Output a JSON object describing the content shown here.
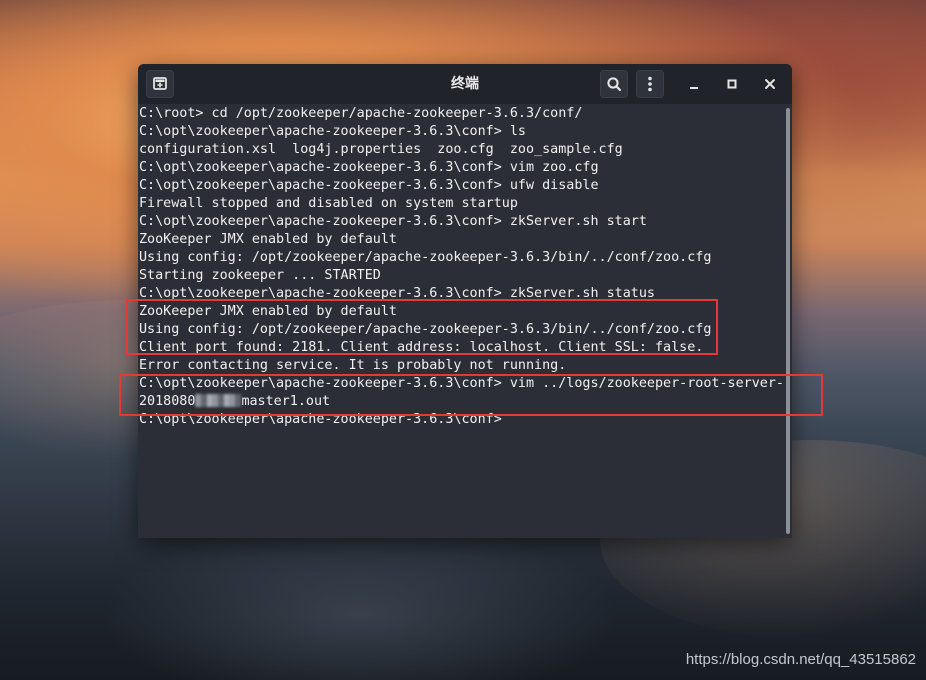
{
  "window": {
    "title": "终端",
    "icons": {
      "new_tab": "new-tab-icon",
      "search": "search-icon",
      "menu": "kebab-menu-icon",
      "minimize": "minimize-icon",
      "maximize": "maximize-icon",
      "close": "close-icon"
    }
  },
  "terminal": {
    "lines": [
      "C:\\root> cd /opt/zookeeper/apache-zookeeper-3.6.3/conf/",
      "C:\\opt\\zookeeper\\apache-zookeeper-3.6.3\\conf> ls",
      "configuration.xsl  log4j.properties  zoo.cfg  zoo_sample.cfg",
      "C:\\opt\\zookeeper\\apache-zookeeper-3.6.3\\conf> vim zoo.cfg",
      "C:\\opt\\zookeeper\\apache-zookeeper-3.6.3\\conf> ufw disable",
      "Firewall stopped and disabled on system startup",
      "C:\\opt\\zookeeper\\apache-zookeeper-3.6.3\\conf> zkServer.sh start",
      "ZooKeeper JMX enabled by default",
      "Using config: /opt/zookeeper/apache-zookeeper-3.6.3/bin/../conf/zoo.cfg",
      "Starting zookeeper ... STARTED",
      "C:\\opt\\zookeeper\\apache-zookeeper-3.6.3\\conf> zkServer.sh status",
      "ZooKeeper JMX enabled by default",
      "Using config: /opt/zookeeper/apache-zookeeper-3.6.3/bin/../conf/zoo.cfg",
      "Client port found: 2181. Client address: localhost. Client SSL: false.",
      "Error contacting service. It is probably not running.",
      "C:\\opt\\zookeeper\\apache-zookeeper-3.6.3\\conf> vim ../logs/zookeeper-root-server-",
      "C:\\opt\\zookeeper\\apache-zookeeper-3.6.3\\conf>"
    ],
    "blurred_line": {
      "prefix": "2018080",
      "suffix": "master1.out"
    }
  },
  "watermark": "https://blog.csdn.net/qq_43515862",
  "colors": {
    "highlight": "#e53935",
    "terminal_bg": "#2b2e36",
    "titlebar_bg": "#20232a"
  }
}
